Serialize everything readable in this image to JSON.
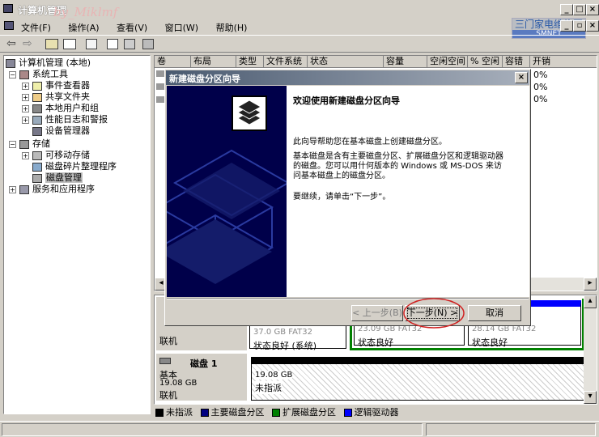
{
  "window": {
    "title": "计算机管理",
    "watermark_left": "by_Miklmf",
    "watermark_right": "三门家电维修网",
    "watermark_right_url": "SMNET"
  },
  "menu": [
    {
      "label": "文件(F)"
    },
    {
      "label": "操作(A)"
    },
    {
      "label": "查看(V)"
    },
    {
      "label": "窗口(W)"
    },
    {
      "label": "帮助(H)"
    }
  ],
  "tree": {
    "root": "计算机管理 (本地)",
    "items": [
      {
        "label": "系统工具"
      },
      {
        "label": "事件查看器"
      },
      {
        "label": "共享文件夹"
      },
      {
        "label": "本地用户和组"
      },
      {
        "label": "性能日志和警报"
      },
      {
        "label": "设备管理器"
      },
      {
        "label": "存储"
      },
      {
        "label": "可移动存储"
      },
      {
        "label": "磁盘碎片整理程序"
      },
      {
        "label": "磁盘管理"
      },
      {
        "label": "服务和应用程序"
      }
    ]
  },
  "volume_columns": [
    "卷",
    "布局",
    "类型",
    "文件系统",
    "状态",
    "容量",
    "空闲空间",
    "% 空闲",
    "容错",
    "开销"
  ],
  "volume_rows": [
    {
      "overhead": "0%"
    },
    {
      "overhead": "0%"
    },
    {
      "overhead": "0%"
    }
  ],
  "disks": {
    "disk0": {
      "status": "联机",
      "partitions": [
        {
          "size": "37.0 GB FAT32",
          "state": "状态良好 (系统)"
        },
        {
          "size": "23.09 GB FAT32",
          "state": "状态良好"
        },
        {
          "size": "28.14 GB FAT32",
          "state": "状态良好"
        }
      ]
    },
    "disk1": {
      "name": "磁盘 1",
      "type": "基本",
      "size": "19.08 GB",
      "status": "联机",
      "partition_size": "19.08 GB",
      "partition_state": "未指派"
    }
  },
  "legend": [
    {
      "label": "未指派",
      "color": "#000000"
    },
    {
      "label": "主要磁盘分区",
      "color": "#000080"
    },
    {
      "label": "扩展磁盘分区",
      "color": "#008000"
    },
    {
      "label": "逻辑驱动器",
      "color": "#0000ff"
    }
  ],
  "wizard": {
    "title": "新建磁盘分区向导",
    "heading": "欢迎使用新建磁盘分区向导",
    "para1": "此向导帮助您在基本磁盘上创建磁盘分区。",
    "para2": "基本磁盘是含有主要磁盘分区、扩展磁盘分区和逻辑驱动器的磁盘。您可以用什何版本的 Windows 或 MS-DOS 来访问基本磁盘上的磁盘分区。",
    "para3": "要继续，请单击“下一步”。",
    "back_label": "< 上一步(B)",
    "next_label": "下一步(N) >",
    "cancel_label": "取消"
  }
}
